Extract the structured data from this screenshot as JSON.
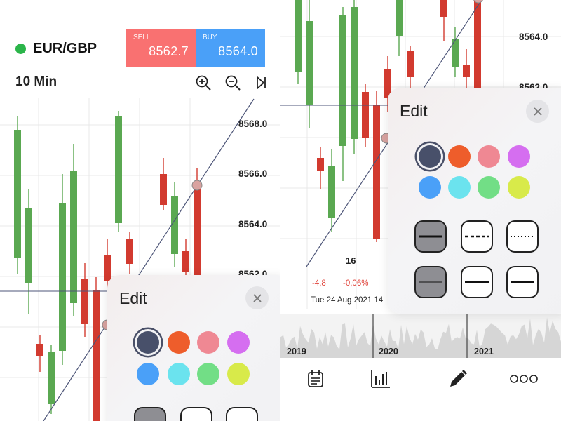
{
  "header": {
    "pair": "EUR/GBP",
    "status_color": "#2bb54a",
    "sell": {
      "label": "SELL",
      "price": "8562.7",
      "color": "#f97171"
    },
    "buy": {
      "label": "BUY",
      "price": "8564.0",
      "color": "#4aa0f8"
    },
    "interval": "10 Min",
    "toolbar_icons": [
      "zoom-in-icon",
      "zoom-out-icon",
      "skip-forward-icon"
    ]
  },
  "left_axis": {
    "prices": [
      "8568.0",
      "8566.0",
      "8564.0",
      "8562.0"
    ]
  },
  "right_axis": {
    "prices": [
      "8564.0",
      "8562.0"
    ]
  },
  "edit_panel": {
    "title": "Edit",
    "close_icon": "close-icon",
    "colors": [
      "#48506a",
      "#ee5d2b",
      "#ef8893",
      "#d56ef0",
      "#4aa0f8",
      "#6be3ee",
      "#72de86",
      "#d8ea4a"
    ],
    "selected_color": 0,
    "line_styles": [
      "solid-thick",
      "dashed",
      "dotted",
      "solid-thin",
      "solid-medium",
      "solid-bold"
    ],
    "selected_style": 0
  },
  "crosshair_info": {
    "x_label": "16",
    "change": "-4,8",
    "change_pct": "-0,06%",
    "datetime": "Tue 24 Aug 2021 14"
  },
  "navigator": {
    "years": [
      "2019",
      "2020",
      "2021"
    ]
  },
  "bottom_tabs": [
    "calendar-icon",
    "indicators-icon",
    "draw-icon",
    "more-icon"
  ],
  "colors": {
    "up": "#5aa851",
    "down": "#d23a2f",
    "crosshair": "#4d5578",
    "trendline": "#4d5578"
  }
}
